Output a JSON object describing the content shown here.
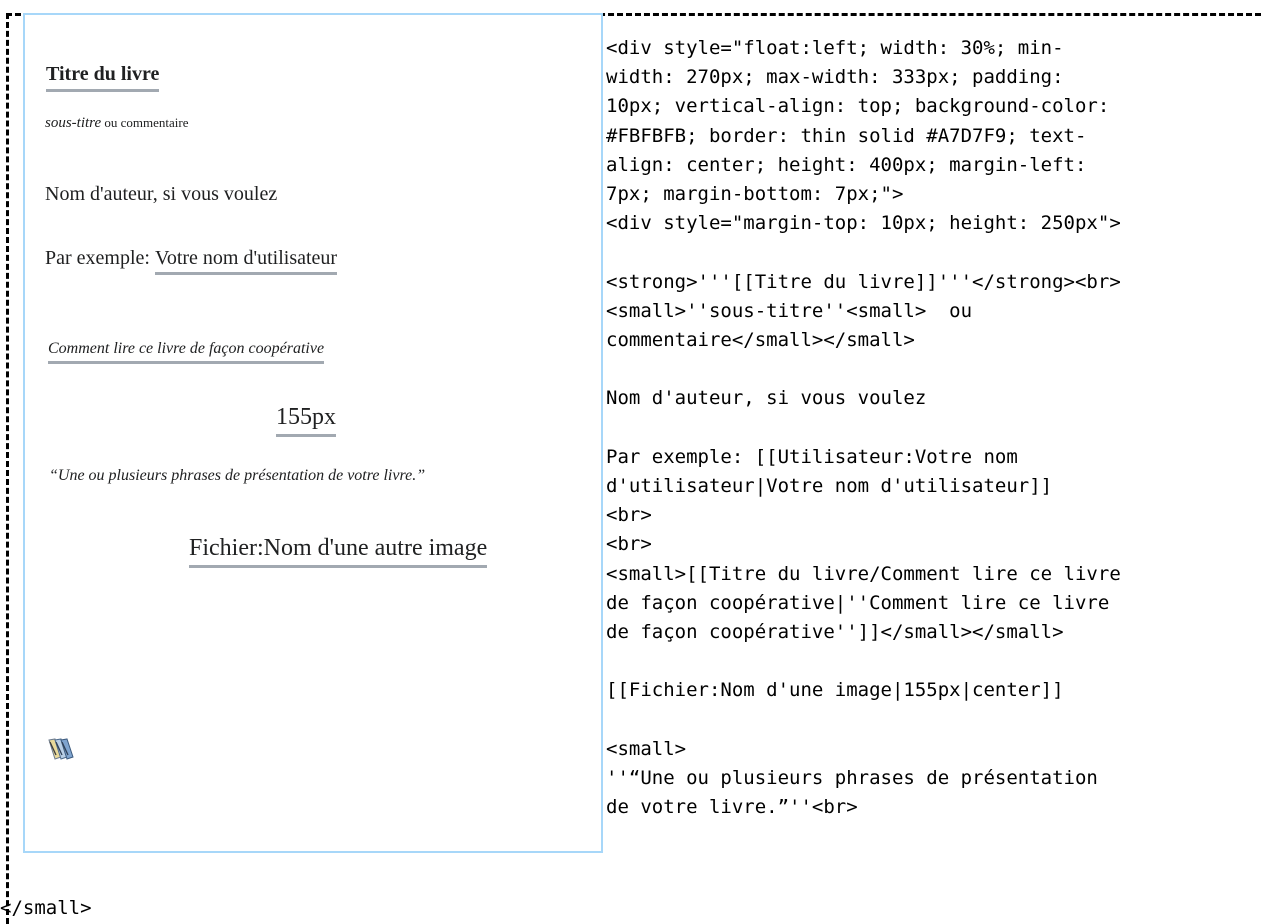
{
  "preview": {
    "title": "Titre du livre",
    "subtitle_italic": "sous-titre",
    "subtitle_comment": " ou commentaire",
    "author_line": "Nom d'auteur, si vous voulez",
    "example_prefix": "Par exemple:",
    "example_link": "Votre nom d'utilisateur",
    "coop_link": "Comment lire ce livre de façon coopérative",
    "image_size": "155px",
    "quote": "“Une ou plusieurs phrases de présentation de votre livre.”",
    "other_image_link": "Fichier:Nom d'une autre image",
    "books_icon": "books-icon"
  },
  "code": {
    "lines": [
      "<div style=\"float:left; width: 30%; min-",
      "width: 270px; max-width: 333px; padding:",
      "10px; vertical-align: top; background-color:",
      "#FBFBFB; border: thin solid #A7D7F9; text-",
      "align: center; height: 400px; margin-left:",
      "7px; margin-bottom: 7px;\">",
      "<div style=\"margin-top: 10px; height: 250px\">",
      "",
      "<strong>'''[[Titre du livre]]'''</strong><br>",
      "<small>''sous-titre''<small>  ou",
      "commentaire</small></small>",
      "",
      "Nom d'auteur, si vous voulez",
      "",
      "Par exemple: [[Utilisateur:Votre nom",
      "d'utilisateur|Votre nom d'utilisateur]]",
      "<br>",
      "<br>",
      "<small>[[Titre du livre/Comment lire ce livre",
      "de façon coopérative|''Comment lire ce livre",
      "de façon coopérative'']]</small></small>",
      "",
      "[[Fichier:Nom d'une image|155px|center]]",
      "",
      "<small>",
      "''“Une ou plusieurs phrases de présentation",
      "de votre livre.”''<br>"
    ],
    "tail": "</small>"
  }
}
